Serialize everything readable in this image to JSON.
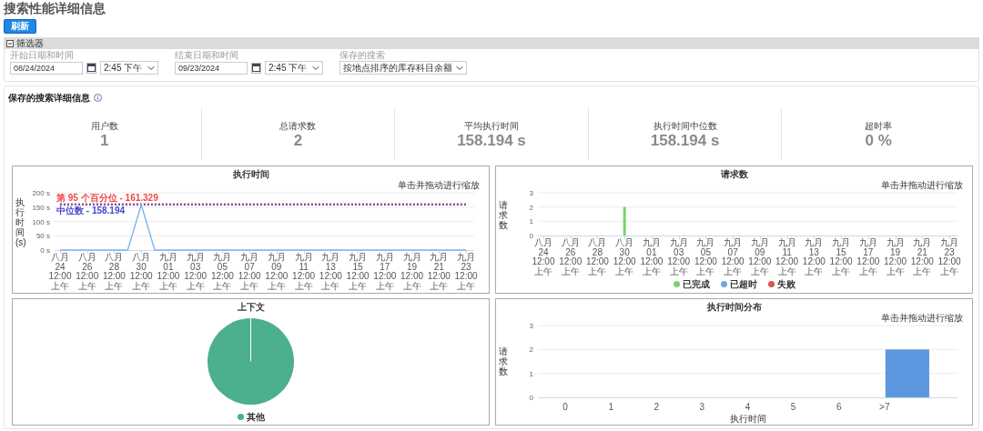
{
  "page_title": "搜索性能详细信息",
  "refresh_button": "刷新",
  "filter_panel": {
    "title": "筛选器",
    "expanded": true,
    "fields": [
      {
        "kind": "datetime",
        "label": "开始日期和时间",
        "date": "08/24/2024",
        "time": "2:45 下午"
      },
      {
        "kind": "datetime",
        "label": "结束日期和时间",
        "date": "09/23/2024",
        "time": "2:45 下午"
      },
      {
        "kind": "select",
        "label": "保存的搜索",
        "value": "按地点排序的库存科目余额"
      }
    ]
  },
  "details": {
    "title": "保存的搜索详细信息",
    "stats": [
      {
        "label": "用户数",
        "value": "1"
      },
      {
        "label": "总请求数",
        "value": "2"
      },
      {
        "label": "平均执行时间",
        "value": "158.194 s"
      },
      {
        "label": "执行时间中位数",
        "value": "158.194 s"
      },
      {
        "label": "超时率",
        "value": "0 %"
      }
    ]
  },
  "charts": [
    {
      "kind": "timeline",
      "subtitle": "单击并拖动进行缩放",
      "chart_data": {
        "type": "line",
        "title": "执行时间",
        "ylabel": "执行时间(s)",
        "categories": [
          "八月 24 12:00 上午",
          null,
          "八月 26 12:00 上午",
          null,
          "八月 28 12:00 上午",
          null,
          "八月 30 12:00 上午",
          null,
          "九月 01 12:00 上午",
          null,
          "九月 03 12:00 上午",
          null,
          "九月 05 12:00 上午",
          null,
          "九月 07 12:00 上午",
          null,
          "九月 09 12:00 上午",
          null,
          "九月 11 12:00 上午",
          null,
          "九月 13 12:00 上午",
          null,
          "九月 15 12:00 上午",
          null,
          "九月 17 12:00 上午",
          null,
          "九月 19 12:00 上午",
          null,
          "九月 21 12:00 上午",
          null,
          "九月 23 12:00 上午"
        ],
        "series": [
          {
            "color": "#7cb5ec",
            "values": [
              0,
              0,
              0,
              0,
              0,
              0,
              158,
              0,
              0,
              0,
              0,
              0,
              0,
              0,
              0,
              0,
              0,
              0,
              0,
              0,
              0,
              0,
              0,
              0,
              0,
              0,
              0,
              0,
              0,
              0,
              0
            ]
          },
          {
            "name": "第 95 个百分位 - 161.329",
            "color": "#f04848",
            "line_style": "dotted",
            "values": [
              161.329,
              161.329,
              161.329,
              161.329,
              161.329,
              161.329,
              161.329,
              161.329,
              161.329,
              161.329,
              161.329,
              161.329,
              161.329,
              161.329,
              161.329,
              161.329,
              161.329,
              161.329,
              161.329,
              161.329,
              161.329,
              161.329,
              161.329,
              161.329,
              161.329,
              161.329,
              161.329,
              161.329,
              161.329,
              161.329,
              161.329
            ]
          },
          {
            "name": "中位数 - 158.194",
            "color": "#4848d0",
            "line_style": "dotted",
            "values": [
              158.194,
              158.194,
              158.194,
              158.194,
              158.194,
              158.194,
              158.194,
              158.194,
              158.194,
              158.194,
              158.194,
              158.194,
              158.194,
              158.194,
              158.194,
              158.194,
              158.194,
              158.194,
              158.194,
              158.194,
              158.194,
              158.194,
              158.194,
              158.194,
              158.194,
              158.194,
              158.194,
              158.194,
              158.194,
              158.194,
              158.194
            ]
          }
        ],
        "ylim": [
          0,
          200
        ],
        "grid": true,
        "yticks": [
          {
            "value": 0,
            "label": "0 s"
          },
          {
            "value": 50,
            "label": "50 s"
          },
          {
            "value": 100,
            "label": "100 s"
          },
          {
            "value": 150,
            "label": "150 s"
          },
          {
            "value": 200,
            "label": "200 s"
          }
        ]
      }
    },
    {
      "kind": "timeline",
      "subtitle": "单击并拖动进行缩放",
      "chart_data": {
        "type": "bar",
        "title": "请求数",
        "ylabel": "请求数",
        "categories": [
          "八月 24 12:00 上午",
          null,
          "八月 26 12:00 上午",
          null,
          "八月 28 12:00 上午",
          null,
          "八月 30 12:00 上午",
          null,
          "九月 01 12:00 上午",
          null,
          "九月 03 12:00 上午",
          null,
          "九月 05 12:00 上午",
          null,
          "九月 07 12:00 上午",
          null,
          "九月 09 12:00 上午",
          null,
          "九月 11 12:00 上午",
          null,
          "九月 13 12:00 上午",
          null,
          "九月 15 12:00 上午",
          null,
          "九月 17 12:00 上午",
          null,
          "九月 19 12:00 上午",
          null,
          "九月 21 12:00 上午",
          null,
          "九月 23 12:00 上午"
        ],
        "series": [
          {
            "name": "已完成",
            "color": "#7cd36e",
            "values": [
              0,
              0,
              0,
              0,
              0,
              0,
              2,
              0,
              0,
              0,
              0,
              0,
              0,
              0,
              0,
              0,
              0,
              0,
              0,
              0,
              0,
              0,
              0,
              0,
              0,
              0,
              0,
              0,
              0,
              0,
              0
            ]
          },
          {
            "name": "已超时",
            "color": "#6ea8dc",
            "values": [
              0,
              0,
              0,
              0,
              0,
              0,
              0,
              0,
              0,
              0,
              0,
              0,
              0,
              0,
              0,
              0,
              0,
              0,
              0,
              0,
              0,
              0,
              0,
              0,
              0,
              0,
              0,
              0,
              0,
              0,
              0
            ]
          },
          {
            "name": "失败",
            "color": "#d9534f",
            "values": [
              0,
              0,
              0,
              0,
              0,
              0,
              0,
              0,
              0,
              0,
              0,
              0,
              0,
              0,
              0,
              0,
              0,
              0,
              0,
              0,
              0,
              0,
              0,
              0,
              0,
              0,
              0,
              0,
              0,
              0,
              0
            ]
          }
        ],
        "ylim": [
          0,
          3
        ],
        "grid": true,
        "yticks": [
          0,
          1,
          2,
          3
        ]
      }
    },
    {
      "kind": "pie",
      "chart_data": {
        "type": "pie",
        "title": "上下文",
        "series": [
          {
            "name": "其他",
            "color": "#4caf8f",
            "values": [
              1
            ]
          }
        ]
      }
    },
    {
      "kind": "histogram",
      "subtitle": "单击并拖动进行缩放",
      "chart_data": {
        "type": "bar",
        "title": "执行时间分布",
        "xlabel": "执行时间",
        "ylabel": "请求数",
        "categories": [
          "0",
          "1",
          "2",
          "3",
          "4",
          "5",
          "6",
          ">7"
        ],
        "series": [
          {
            "color": "#5b97de",
            "values": [
              0,
              0,
              0,
              0,
              0,
              0,
              0,
              2
            ]
          }
        ],
        "ylim": [
          0,
          3
        ],
        "grid": true,
        "yticks": [
          0,
          1,
          2,
          3
        ]
      }
    }
  ]
}
